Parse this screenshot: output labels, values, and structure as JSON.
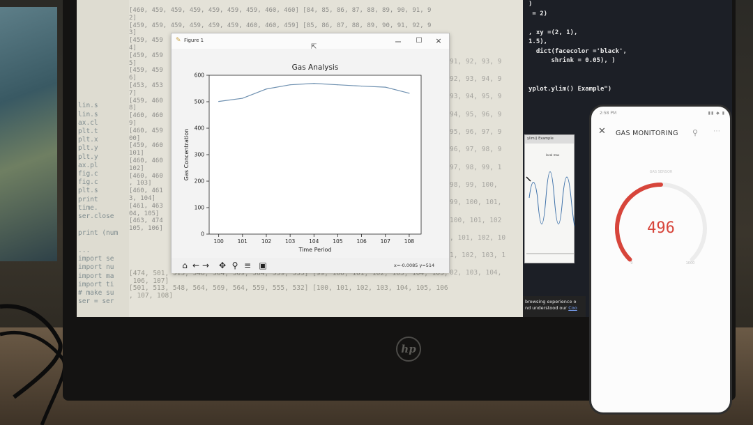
{
  "console": {
    "gutter_lines": [
      "",
      "",
      "",
      "",
      "",
      "",
      "",
      "",
      "",
      "",
      "",
      "",
      "lin.s",
      "lin.s",
      "ax.cl",
      "plt.t",
      "plt.x",
      "plt.y",
      "plt.y",
      "ax.pl",
      "fig.c",
      "fig.c",
      "plt.s",
      "print",
      "time.",
      "ser.close",
      "",
      "print (num",
      "",
      "...",
      "import se",
      "import nu",
      "import ma",
      "import ti",
      "# make su",
      "ser = ser"
    ],
    "mid_lines": [
      "[460, 459, 459, 459, 459, 459, 459, 460, 460] [84, 85, 86, 87, 88, 89, 90, 91, 9",
      "2]",
      "[459, 459, 459, 459, 459, 459, 460, 460, 459] [85, 86, 87, 88, 89, 90, 91, 92, 9",
      "3]",
      "[459, 459",
      "4]",
      "[459, 459",
      "5]",
      "[459, 459",
      "6]",
      "[453, 453",
      "7]",
      "[459, 460",
      "8]",
      "[460, 460",
      "9]",
      "[460, 459",
      "00]",
      "[459, 460",
      "101]",
      "[460, 460",
      "102]",
      "[460, 460",
      ", 103]",
      "[460, 461",
      "3, 104]",
      "[461, 463",
      "04, 105]",
      "[463, 474",
      "105, 106]"
    ],
    "right_strip": [
      "",
      "",
      "",
      "91, 92, 93, 9",
      "92, 93, 94, 9",
      "93, 94, 95, 9",
      "94, 95, 96, 9",
      "95, 96, 97, 9",
      "96, 97, 98, 9",
      "97, 98, 99, 1",
      "98, 99, 100,",
      "99, 100, 101,",
      "100, 101, 102",
      ", 101, 102, 10",
      "1, 102, 103, 1",
      "02, 103, 104,"
    ],
    "bottom_lines": [
      "[474, 501, 513, 548, 564, 569, 564, 559, 555] [99, 100, 101, 102, 103, 104, 105,",
      " 106, 107]",
      "[501, 513, 548, 564, 569, 564, 559, 555, 532] [100, 101, 102, 103, 104, 105, 106",
      ", 107, 108]"
    ]
  },
  "code_right": {
    "lines": [
      ")",
      " = 2)",
      "",
      ", xy =(2, 1),",
      "1.5),",
      "  dict(facecolor ='black',",
      "      shrink = 0.05), )",
      "",
      "",
      "yplot.ylim() Example\")"
    ]
  },
  "ylim_example": {
    "title": "ylim() Example",
    "annotation": "local max"
  },
  "cookie_banner": {
    "line1": "browsing experience o",
    "line2": "nd understood our ",
    "link": "Coo"
  },
  "figure_window": {
    "title": "Figure 1",
    "toolbar_icons": [
      "home-icon",
      "back-arrow-icon",
      "forward-arrow-icon",
      "pan-icon",
      "zoom-icon",
      "configure-icon",
      "save-icon"
    ],
    "coordinate_readout": "x=-0.0085 y=514"
  },
  "chart_data": {
    "type": "line",
    "title": "Gas Analysis",
    "xlabel": "Time Period",
    "ylabel": "Gas Concentration",
    "x": [
      100,
      101,
      102,
      103,
      104,
      105,
      106,
      107,
      108
    ],
    "series": [
      {
        "values": [
          501,
          513,
          548,
          564,
          569,
          564,
          559,
          555,
          532
        ],
        "color": "#6e90b0"
      }
    ],
    "xticks": [
      100,
      101,
      102,
      103,
      104,
      105,
      106,
      107,
      108
    ],
    "yticks": [
      0,
      100,
      200,
      300,
      400,
      500,
      600
    ],
    "xlim": [
      99.6,
      108.5
    ],
    "ylim": [
      0,
      600
    ],
    "grid": false
  },
  "phone": {
    "status_time": "2:58 PM",
    "status_icons": "▮▮ ◆ ▮",
    "app_title": "GAS MONITORING",
    "gauge_label": "GAS SENSOR",
    "gauge_value": "496",
    "gauge_min": "0",
    "gauge_max": "1000",
    "gauge_fraction": 0.5,
    "gauge_color": "#d7453b",
    "gauge_track_color": "#ececec"
  }
}
